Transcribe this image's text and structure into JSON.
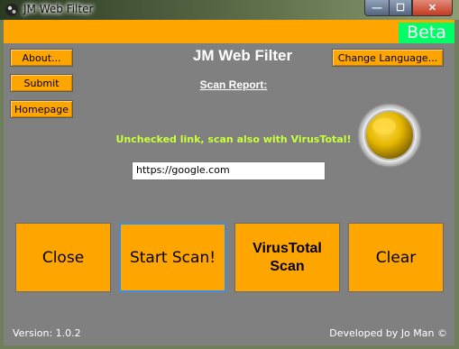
{
  "window": {
    "title": "JM Web Filter",
    "controls": {
      "minimize": "—",
      "maximize": "☐",
      "close": "✕"
    }
  },
  "topbar": {
    "badge": "Beta"
  },
  "left_menu": {
    "about": "About...",
    "submit": "Submit",
    "homepage": "Homepage"
  },
  "header": {
    "title": "JM Web Filter",
    "change_language": "Change Language...",
    "scan_report": "Scan Report:"
  },
  "hint": "Unchecked link, scan also with VirusTotal!",
  "url_input": {
    "value": "https://google.com"
  },
  "actions": {
    "close": "Close",
    "start_scan": "Start Scan!",
    "virustotal_line1": "VirusTotal",
    "virustotal_line2": "Scan",
    "clear": "Clear"
  },
  "footer": {
    "version": "Version: 1.0.2",
    "developer": "Developed by Jo Man ©"
  },
  "colors": {
    "accent": "#ffa500",
    "beta": "#00ff66",
    "background": "#808080",
    "hint": "#c8ff3c",
    "status_light": "#e6b800"
  },
  "icons": {
    "app": "app-logo-icon",
    "status": "status-light-icon"
  }
}
